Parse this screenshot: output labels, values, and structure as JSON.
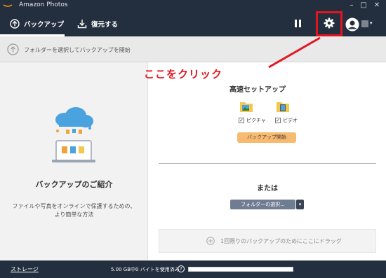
{
  "window": {
    "title": "Amazon Photos",
    "buttons": {
      "minimize": "–",
      "maximize": "□",
      "close": "✕"
    }
  },
  "nav": {
    "tabs": [
      {
        "label": "バックアップ",
        "icon": "upload-circle-icon",
        "active": true
      },
      {
        "label": "復元する",
        "icon": "download-icon",
        "active": false
      }
    ]
  },
  "instruction": {
    "text": "フォルダーを選択してバックアップを開始"
  },
  "intro": {
    "title": "バックアップのご紹介",
    "description_line1": "ファイルや写真をオンラインで保護するための、",
    "description_line2": "より簡単な方法"
  },
  "fast_setup": {
    "title": "高速セットアップ",
    "folders": [
      {
        "label": "ピクチャ",
        "checked": true,
        "icon": "pictures-folder-icon"
      },
      {
        "label": "ビデオ",
        "checked": true,
        "icon": "videos-folder-icon"
      }
    ],
    "start_button": "バックアップ開始"
  },
  "alt": {
    "or_text": "または",
    "select_button": "フォルダーの選択...",
    "drop_text": "1回限りのバックアップのためにここにドラッグ"
  },
  "status": {
    "storage_link": "ストレージ",
    "usage_text": "5.00 GB中0 バイトを使用済み",
    "help": "?",
    "usage_fraction": 0
  },
  "annotation": {
    "text": "ここをクリック"
  },
  "colors": {
    "dark": "#232f3e",
    "highlight": "#e4141e",
    "start_button": "#f7ba71",
    "select_button": "#6f7c91"
  }
}
